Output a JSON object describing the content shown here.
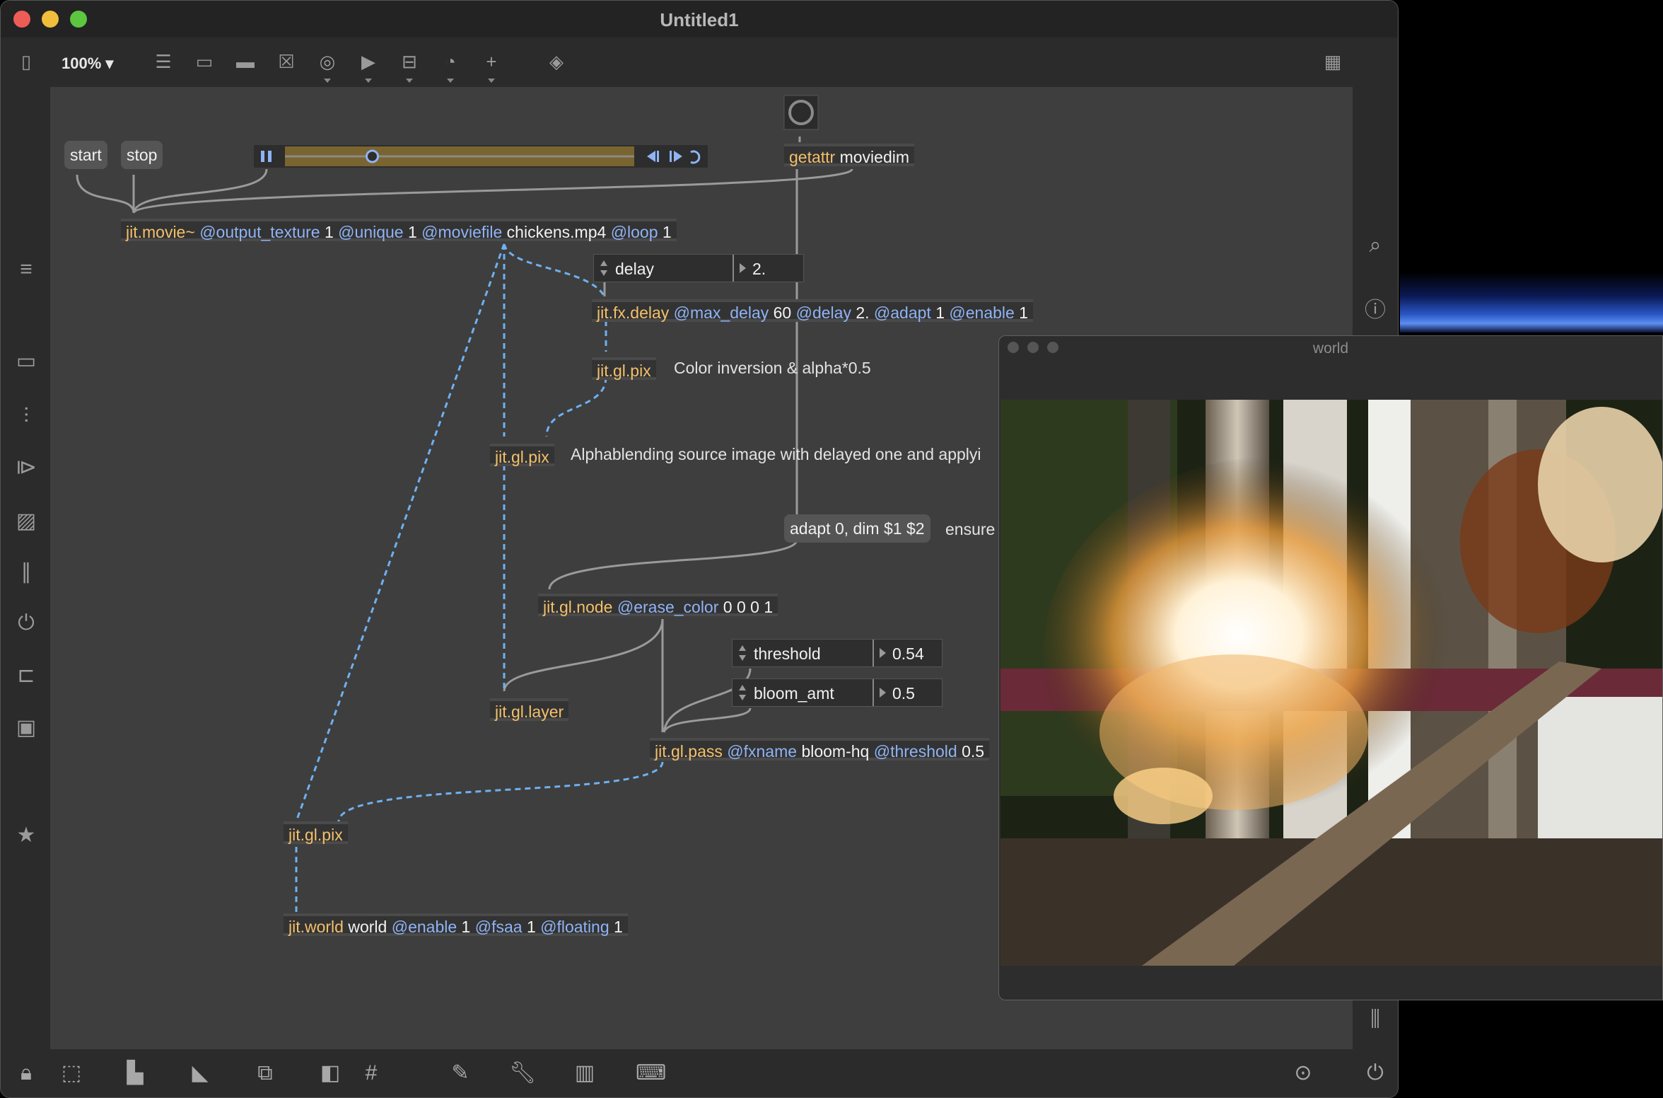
{
  "window": {
    "title": "Untitled1"
  },
  "toolbar": {
    "zoom": "100% ▾"
  },
  "patch": {
    "messages": {
      "start": "start",
      "stop": "stop",
      "adapt": "adapt 0, dim $1 $2"
    },
    "getattr": {
      "k": "getattr",
      "w": "moviedim"
    },
    "movie": {
      "k": "jit.movie~",
      "a1": "@output_texture",
      "v1": "1",
      "a2": "@unique",
      "v2": "1",
      "a3": "@moviefile",
      "v3": "chickens.mp4",
      "a4": "@loop",
      "v4": "1"
    },
    "fxdelay": {
      "k": "jit.fx.delay",
      "a1": "@max_delay",
      "v1": "60",
      "a2": "@delay",
      "v2": "2.",
      "a3": "@adapt",
      "v3": "1",
      "a4": "@enable",
      "v4": "1"
    },
    "pix1": "jit.gl.pix",
    "pix2": "jit.gl.pix",
    "pix3": "jit.gl.pix",
    "node": {
      "k": "jit.gl.node",
      "a1": "@erase_color",
      "v1": "0 0 0 1"
    },
    "layer": "jit.gl.layer",
    "pass": {
      "k": "jit.gl.pass",
      "a1": "@fxname",
      "v1": "bloom-hq",
      "a2": "@threshold",
      "v2": "0.5"
    },
    "world": {
      "k": "jit.world",
      "w": "world",
      "a1": "@enable",
      "v1": "1",
      "a2": "@fsaa",
      "v2": "1",
      "a3": "@floating",
      "v3": "1"
    },
    "attrui": {
      "delay": {
        "label": "delay",
        "value": "2."
      },
      "threshold": {
        "label": "threshold",
        "value": "0.54"
      },
      "bloom": {
        "label": "bloom_amt",
        "value": "0.5"
      }
    },
    "comments": {
      "c1": "Color inversion & alpha*0.5",
      "c2": "Alphablending source image with delayed one and applyi",
      "c3": "ensure"
    },
    "transport": {
      "playhead_fraction": 0.25
    }
  },
  "world_window": {
    "title": "world"
  },
  "colors": {
    "canvas": "#3e3e3e",
    "object_name": "#f3c06b",
    "attribute": "#8fb3f5",
    "texture_wire": "#6fb0f0",
    "wire": "#9a9a9a",
    "transport_bar": "#7a6430"
  }
}
